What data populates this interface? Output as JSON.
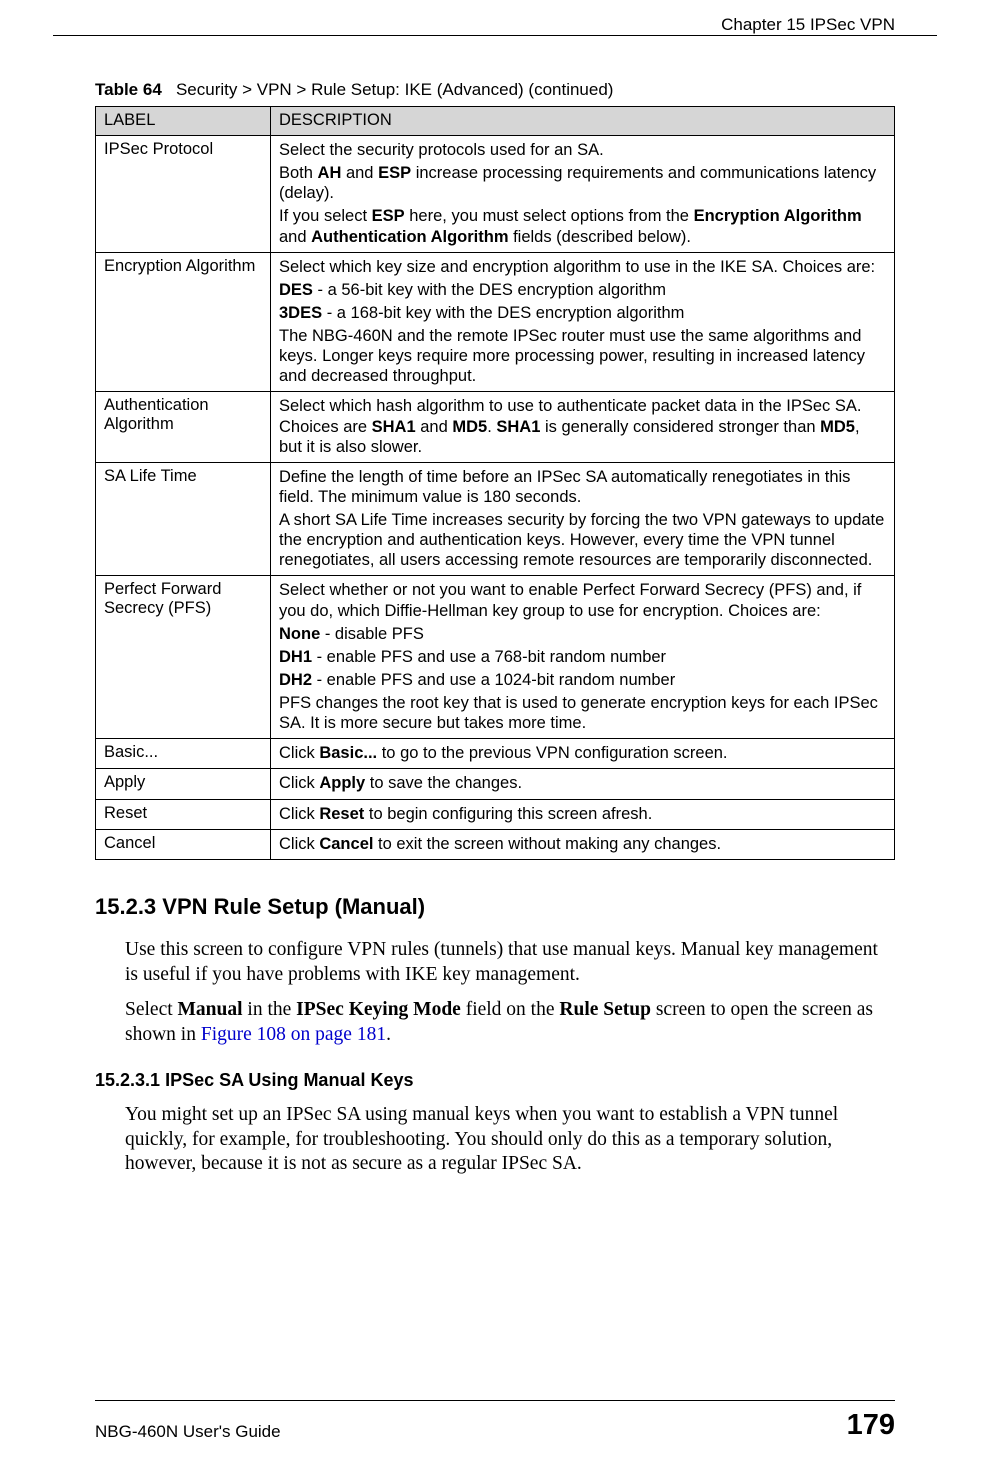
{
  "header": {
    "chapter": "Chapter 15 IPSec VPN"
  },
  "table": {
    "caption_prefix": "Table 64",
    "caption_rest": "Security > VPN > Rule Setup: IKE (Advanced)  (continued)",
    "col_label": "LABEL",
    "col_desc": "DESCRIPTION",
    "rows": {
      "r0_label": "IPSec Protocol",
      "r0_p1": "Select the security protocols used for an SA.",
      "r0_p2a": "Both ",
      "r0_p2b": "AH",
      "r0_p2c": " and ",
      "r0_p2d": "ESP",
      "r0_p2e": " increase processing requirements and communications latency (delay).",
      "r0_p3a": "If you select ",
      "r0_p3b": "ESP",
      "r0_p3c": " here, you must select options from the ",
      "r0_p3d": "Encryption Algorithm",
      "r0_p3e": " and ",
      "r0_p3f": "Authentication Algorithm",
      "r0_p3g": " fields (described below).",
      "r1_label": "Encryption Algorithm",
      "r1_p1": "Select which key size and encryption algorithm to use in the IKE SA. Choices are:",
      "r1_p2a": "DES",
      "r1_p2b": " - a 56-bit key with the DES encryption algorithm",
      "r1_p3a": "3DES",
      "r1_p3b": " - a 168-bit key with the DES encryption algorithm",
      "r1_p4": "The NBG-460N and the remote IPSec router must use the same algorithms and keys. Longer keys require more processing power, resulting in increased latency and decreased throughput.",
      "r2_label": "Authentication Algorithm",
      "r2_p1a": "Select which hash algorithm to use to authenticate packet data in the IPSec SA. Choices are ",
      "r2_p1b": "SHA1",
      "r2_p1c": " and ",
      "r2_p1d": "MD5",
      "r2_p1e": ". ",
      "r2_p1f": "SHA1",
      "r2_p1g": " is generally considered stronger than ",
      "r2_p1h": "MD5",
      "r2_p1i": ", but it is also slower.",
      "r3_label": "SA Life Time",
      "r3_p1": "Define the length of time before an IPSec SA automatically renegotiates in this field. The minimum value is 180 seconds.",
      "r3_p2": "A short SA Life Time increases security by forcing the two VPN gateways to update the encryption and authentication keys. However, every time the VPN tunnel renegotiates, all users accessing remote resources are temporarily disconnected.",
      "r4_label": "Perfect Forward Secrecy (PFS)",
      "r4_p1": "Select whether or not you want to enable Perfect Forward Secrecy (PFS) and, if you do, which Diffie-Hellman key group to use for encryption. Choices are:",
      "r4_p2a": "None",
      "r4_p2b": " - disable PFS",
      "r4_p3a": "DH1",
      "r4_p3b": " - enable PFS and use a 768-bit random number",
      "r4_p4a": "DH2",
      "r4_p4b": " - enable PFS and use a 1024-bit random number",
      "r4_p5": "PFS changes the root key that is used to generate encryption keys for each IPSec SA. It is more secure but takes more time.",
      "r5_label": "Basic...",
      "r5_p1a": "Click ",
      "r5_p1b": "Basic...",
      "r5_p1c": " to go to the previous VPN configuration screen.",
      "r6_label": "Apply",
      "r6_p1a": "Click ",
      "r6_p1b": "Apply",
      "r6_p1c": " to save the changes.",
      "r7_label": "Reset",
      "r7_p1a": "Click ",
      "r7_p1b": "Reset",
      "r7_p1c": " to begin configuring this screen afresh.",
      "r8_label": "Cancel",
      "r8_p1a": "Click ",
      "r8_p1b": "Cancel",
      "r8_p1c": " to exit the screen without making any changes."
    }
  },
  "section": {
    "num": "15.2.3  ",
    "title": "VPN Rule Setup (Manual)",
    "para1": "Use this screen to configure VPN rules (tunnels) that use manual keys. Manual key management is useful if you have problems with IKE key management.",
    "para2a": "Select ",
    "para2b": "Manual",
    "para2c": " in the ",
    "para2d": "IPSec Keying Mode",
    "para2e": " field on the ",
    "para2f": "Rule Setup",
    "para2g": " screen to open the screen as shown in ",
    "para2_link": "Figure 108 on page 181",
    "para2_end": "."
  },
  "subsection": {
    "num": "15.2.3.1  ",
    "title": "IPSec SA Using Manual Keys",
    "para1": "You might set up an IPSec SA using manual keys when you want to establish a VPN tunnel quickly, for example, for troubleshooting. You should only do this as a temporary solution, however, because it is not as secure as a regular IPSec SA."
  },
  "footer": {
    "left": "NBG-460N User's Guide",
    "right": "179"
  }
}
